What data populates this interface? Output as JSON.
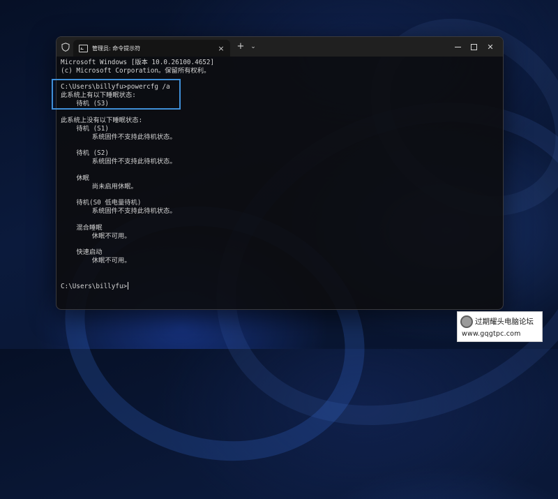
{
  "terminal": {
    "tab_title": "管理员: 命令提示符",
    "tab_close": "×",
    "new_tab": "+",
    "dropdown": "⌄",
    "caption": {
      "close": "✕"
    },
    "lines": [
      "Microsoft Windows [版本 10.0.26100.4652]",
      "(c) Microsoft Corporation。保留所有权利。",
      "",
      "C:\\Users\\billyfu>powercfg /a",
      "此系统上有以下睡眠状态:",
      "    待机 (S3)",
      "",
      "此系统上没有以下睡眠状态:",
      "    待机 (S1)",
      "        系统固件不支持此待机状态。",
      "",
      "    待机 (S2)",
      "        系统固件不支持此待机状态。",
      "",
      "    休眠",
      "        尚未启用休眠。",
      "",
      "    待机(S0 低电量待机)",
      "        系统固件不支持此待机状态。",
      "",
      "    混合睡眠",
      "        休眠不可用。",
      "",
      "    快速启动",
      "        休眠不可用。",
      "",
      "",
      "C:\\Users\\billyfu>"
    ],
    "highlight_color": "#3f8fd8"
  },
  "watermark": {
    "text": "过期耀头电脑论坛",
    "url": "www.gqgtpc.com"
  }
}
